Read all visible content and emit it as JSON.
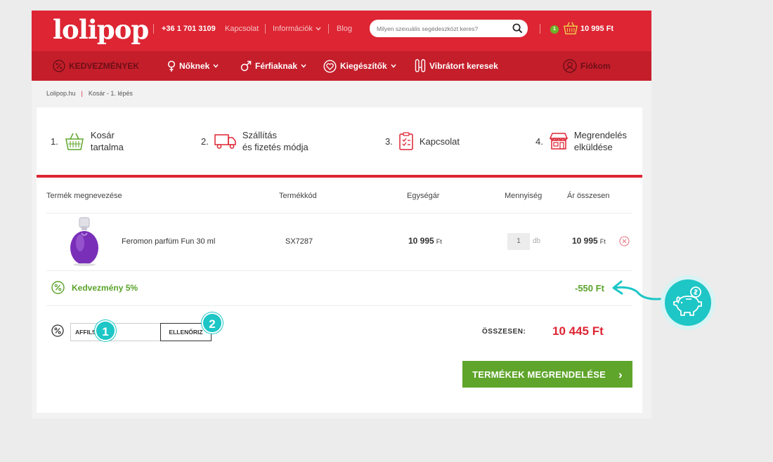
{
  "header": {
    "logo": "lolipop",
    "phone": "+36 1 701 3109",
    "links": [
      "Kapcsolat",
      "Információk",
      "Blog"
    ],
    "search_placeholder": "Milyen szexuális segédeszközt keres?",
    "cart_count": "1",
    "cart_total": "10 995 Ft"
  },
  "nav": {
    "items": [
      "KEDVEZMÉNYEK",
      "Nőknek",
      "Férfiaknak",
      "Kiegészítők",
      "Vibrátort keresek",
      "Fiókom"
    ]
  },
  "breadcrumb": {
    "home": "Lolipop.hu",
    "current": "Kosár - 1. lépés"
  },
  "steps": [
    {
      "num": "1.",
      "line1": "Kosár",
      "line2": "tartalma",
      "icon": "basket-icon"
    },
    {
      "num": "2.",
      "line1": "Szállítás",
      "line2": "és fizetés módja",
      "icon": "truck-icon"
    },
    {
      "num": "3.",
      "line1": "Kapcsolat",
      "line2": "",
      "icon": "clipboard-icon"
    },
    {
      "num": "4.",
      "line1": "Megrendelés",
      "line2": "elküldése",
      "icon": "store-icon"
    }
  ],
  "table": {
    "headers": [
      "Termék megnevezése",
      "Termékkód",
      "Egységár",
      "Mennyiség",
      "Ár összesen"
    ],
    "row": {
      "name": "Feromon parfüm Fun 30 ml",
      "code": "SX7287",
      "unit_price": "10 995",
      "currency": "Ft",
      "quantity": "1",
      "unit": "db",
      "total": "10 995"
    }
  },
  "discount": {
    "label": "Kedvezmény 5%",
    "amount": "-550 Ft"
  },
  "coupon": {
    "value": "AFFIL5",
    "button": "ELLENŐRIZ",
    "marker1": "1",
    "marker2": "2"
  },
  "total": {
    "label": "ÖSSZESEN:",
    "value": "10 445 Ft"
  },
  "order_button": {
    "label": "TERMÉKEK MEGRENDELÉSE",
    "arrow": "›"
  },
  "colors": {
    "brand_red": "#dd2533",
    "nav_red": "#c41e2b",
    "green": "#5fa52b",
    "teal": "#1ec6c6"
  }
}
